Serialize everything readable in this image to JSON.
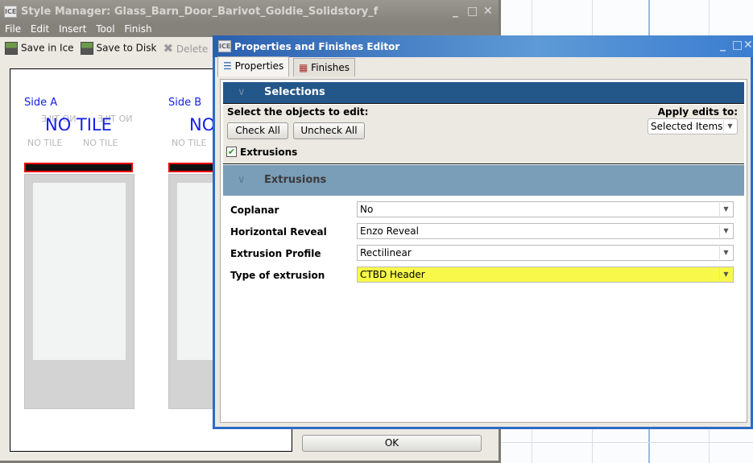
{
  "style_manager": {
    "title": "Style Manager: Glass_Barn_Door_Barivot_Goldie_Solidstory_f",
    "app_icon": "ICE",
    "menu": [
      "File",
      "Edit",
      "Insert",
      "Tool",
      "Finish"
    ],
    "toolbar": {
      "save_in_ice": "Save in Ice",
      "save_to_disk": "Save to Disk",
      "delete": "Delete"
    },
    "canvas": {
      "side_a": "Side A",
      "side_b": "Side B",
      "no_tile_big": "NO TILE",
      "no_tile_big_b": "NO",
      "no_tile": "NO TILE",
      "no_tile_mirror": "NO TILE"
    },
    "ok": "OK"
  },
  "editor": {
    "title": "Properties and Finishes Editor",
    "app_icon": "ICE",
    "tabs": [
      "Properties",
      "Finishes"
    ],
    "selections": {
      "header": "Selections",
      "prompt": "Select the objects to edit:",
      "check_all": "Check All",
      "uncheck_all": "Uncheck All",
      "apply_label": "Apply edits to:",
      "apply_value": "Selected Items",
      "items": [
        {
          "label": "Extrusions",
          "checked": true
        }
      ]
    },
    "extrusions": {
      "header": "Extrusions",
      "rows": [
        {
          "label": "Coplanar",
          "value": "No"
        },
        {
          "label": "Horizontal Reveal",
          "value": "Enzo Reveal"
        },
        {
          "label": "Extrusion Profile",
          "value": "Rectilinear"
        },
        {
          "label": "Type of extrusion",
          "value": "CTBD Header",
          "highlight": "#f8f84a"
        }
      ]
    }
  }
}
